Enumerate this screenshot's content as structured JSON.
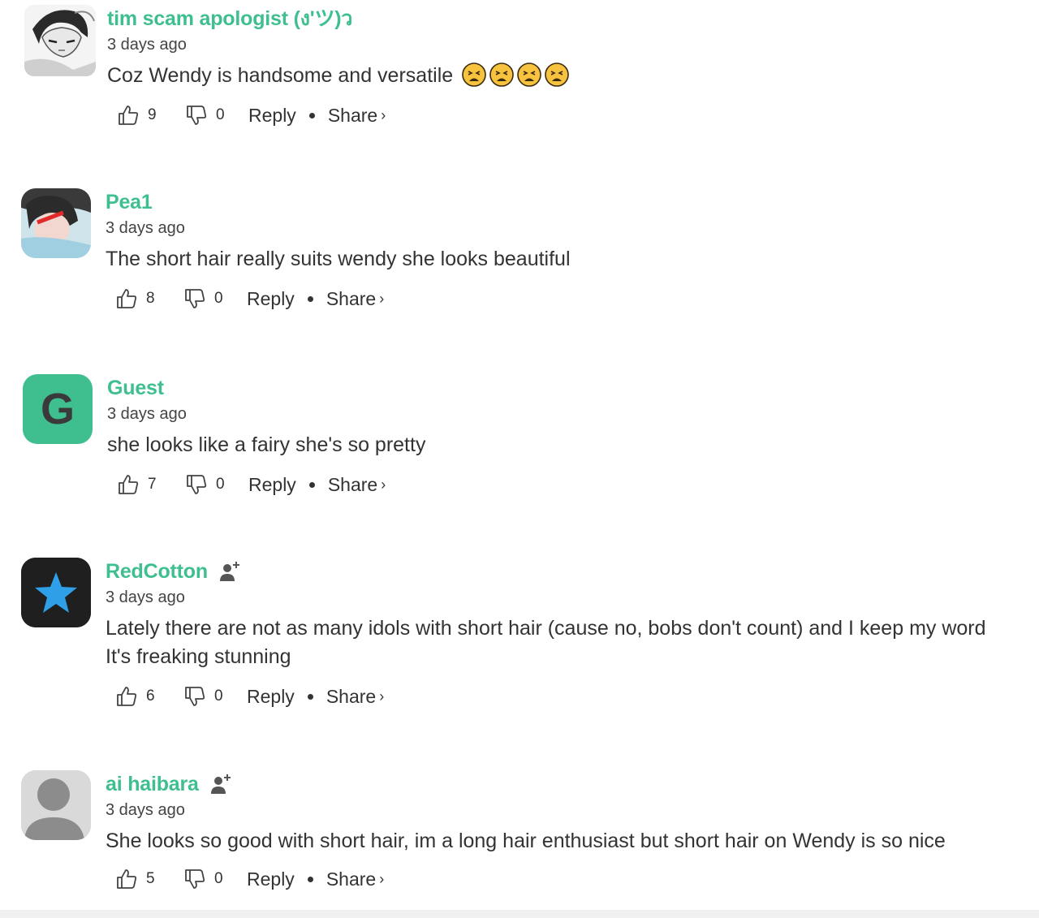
{
  "colors": {
    "username": "#3fbf8f",
    "guest_avatar": "#3fbf8f",
    "star_avatar_bg": "#1f1f1f",
    "star": "#2f9fe8",
    "default_avatar_bg": "#d9d9d9"
  },
  "comments": [
    {
      "username": "tim scam apologist (ง'ツ)ว",
      "time": "3 days ago",
      "text": "Coz Wendy is handsome and versatile",
      "emoji": [
        "tired-face-emoji",
        "tired-face-emoji",
        "tired-face-emoji",
        "tired-face-emoji"
      ],
      "likes": "9",
      "dislikes": "0",
      "reply_label": "Reply",
      "share_label": "Share",
      "avatar": "manga-portrait"
    },
    {
      "username": "Pea1",
      "time": "3 days ago",
      "text": "The short hair really suits wendy she looks beautiful",
      "likes": "8",
      "dislikes": "0",
      "reply_label": "Reply",
      "share_label": "Share",
      "avatar": "photo-portrait"
    },
    {
      "username": "Guest",
      "time": "3 days ago",
      "text": "she looks like a fairy she's so pretty",
      "likes": "7",
      "dislikes": "0",
      "reply_label": "Reply",
      "share_label": "Share",
      "avatar_letter": "G"
    },
    {
      "username": "RedCotton",
      "time": "3 days ago",
      "text_line1": "Lately there are not as many idols with short hair (cause no, bobs don't count) and I keep my word",
      "text_line2": "It's freaking stunning",
      "likes": "6",
      "dislikes": "0",
      "reply_label": "Reply",
      "share_label": "Share",
      "avatar": "star-icon"
    },
    {
      "username": "ai haibara",
      "time": "3 days ago",
      "text": "She looks so good with short hair, im a long hair enthusiast but short hair on Wendy is so nice",
      "likes": "5",
      "dislikes": "0",
      "reply_label": "Reply",
      "share_label": "Share",
      "avatar": "default-user-icon"
    }
  ]
}
